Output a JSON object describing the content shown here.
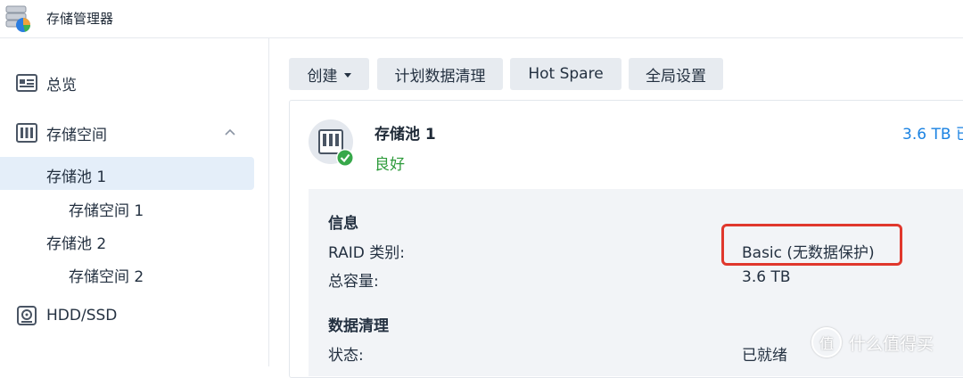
{
  "app": {
    "title": "存储管理器",
    "icon": "storage-manager-icon"
  },
  "sidebar": {
    "items": [
      {
        "label": "总览",
        "icon": "overview-icon"
      },
      {
        "label": "存储空间",
        "icon": "storage-space-icon",
        "expanded": true
      },
      {
        "label": "HDD/SSD",
        "icon": "disk-icon"
      }
    ],
    "sub_items": [
      {
        "label": "存储池 1",
        "selected": true
      },
      {
        "label": "存储空间 1"
      },
      {
        "label": "存储池 2"
      },
      {
        "label": "存储空间 2"
      }
    ]
  },
  "toolbar": {
    "create": "创建",
    "scrub_schedule": "计划数据清理",
    "hot_spare": "Hot Spare",
    "global_settings": "全局设置"
  },
  "pool": {
    "name": "存储池 1",
    "status": "良好",
    "capacity": "3.6 TB 已"
  },
  "info": {
    "section_title": "信息",
    "raid_label": "RAID 类别:",
    "raid_value": "Basic (无数据保护)",
    "capacity_label": "总容量:",
    "capacity_value": "3.6 TB"
  },
  "scrub": {
    "section_title": "数据清理",
    "status_label": "状态:",
    "status_value": "已就绪"
  },
  "watermark": {
    "glyph": "值",
    "text": "什么值得买"
  },
  "colors": {
    "accent": "#1a82e2",
    "good": "#2e9b3b",
    "highlight": "#e0372c",
    "selected_bg": "#e4eef9",
    "button_bg": "#e7ebf0",
    "info_bg": "#f2f4f7"
  }
}
